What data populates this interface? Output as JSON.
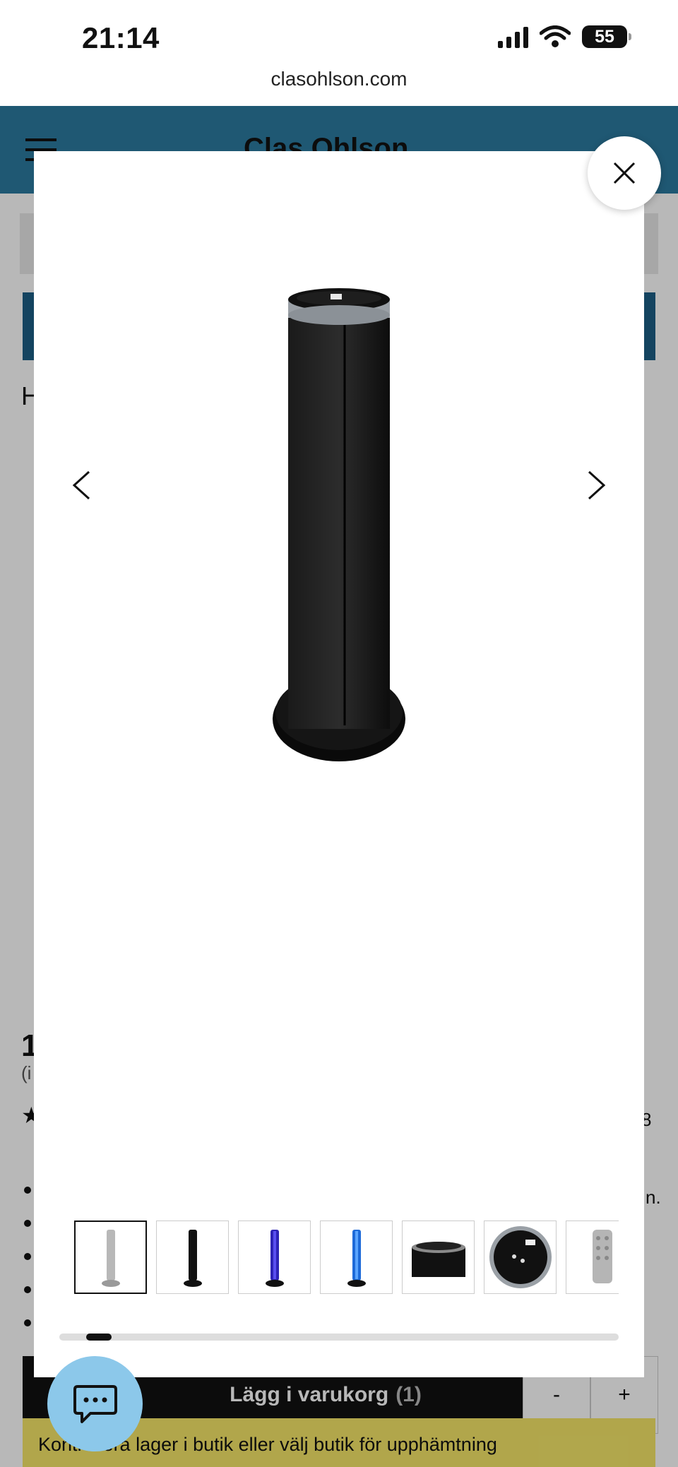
{
  "status_bar": {
    "time": "21:14",
    "battery": "55",
    "signal_icon": "signal-bars-icon",
    "wifi_icon": "wifi-icon"
  },
  "browser": {
    "url": "clasohlson.com"
  },
  "site_header": {
    "logo_text": "Clas Ohlson",
    "menu_icon": "hamburger-menu-icon",
    "search_icon": "search-icon",
    "account_icon": "user-icon",
    "cart_icon": "cart-icon",
    "color": "#2b7ba0"
  },
  "page_peek": {
    "title_start": "H",
    "price_start": "1",
    "price_note": "(i",
    "star": "★",
    "rating_count_tail": "8",
    "list_tail": "n."
  },
  "gallery": {
    "product_name_icon": "tower-fan-image",
    "prev_icon": "chevron-left-icon",
    "next_icon": "chevron-right-icon",
    "thumbnails": [
      {
        "name": "thumb-tower-grey",
        "active": true
      },
      {
        "name": "thumb-tower-black",
        "active": false
      },
      {
        "name": "thumb-tower-blue",
        "active": false
      },
      {
        "name": "thumb-tower-lightblue",
        "active": false
      },
      {
        "name": "thumb-top-closeup",
        "active": false
      },
      {
        "name": "thumb-control-panel",
        "active": false
      },
      {
        "name": "thumb-remote",
        "active": false
      }
    ],
    "scroll_position_fraction": 0.05,
    "close_icon": "close-icon"
  },
  "cart": {
    "add_label": "Lägg i varukorg",
    "count": "(1)",
    "minus": "-",
    "plus": "+"
  },
  "stock_notice": {
    "text": "Kontrollera lager i butik eller välj butik för upphämtning"
  },
  "chat": {
    "icon": "chat-bubble-icon",
    "color": "#8cc8ea"
  }
}
